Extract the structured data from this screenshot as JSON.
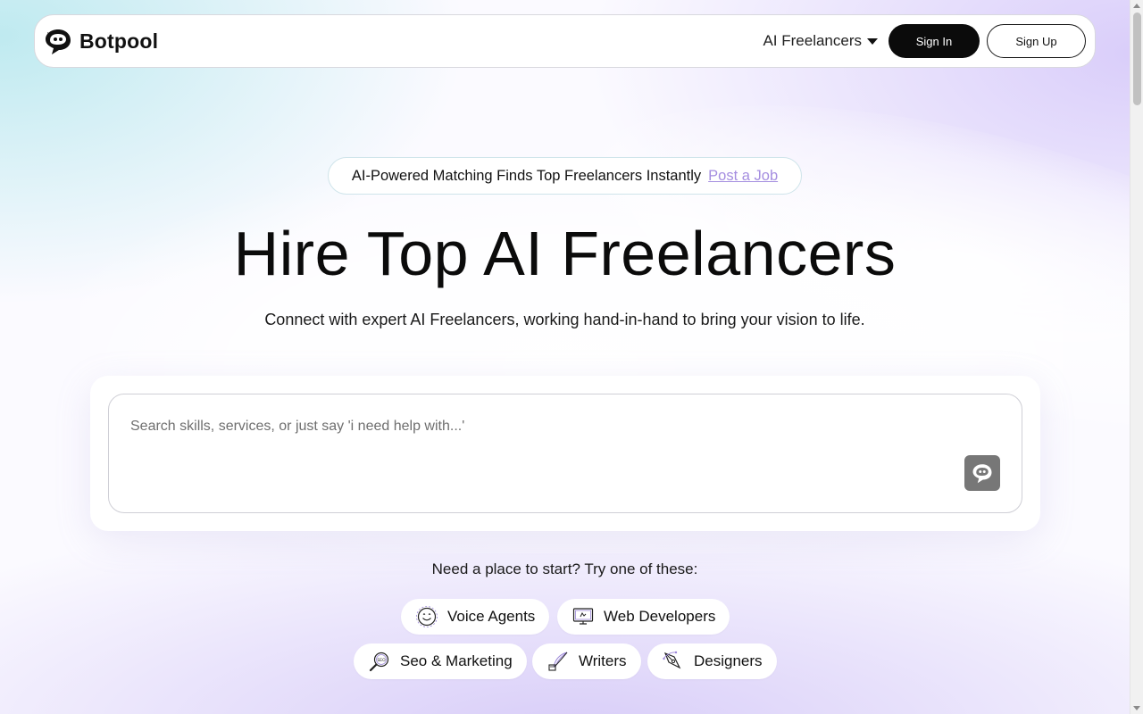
{
  "nav": {
    "brand": "Botpool",
    "dropdown_label": "AI Freelancers",
    "sign_in": "Sign In",
    "sign_up": "Sign Up"
  },
  "hero": {
    "pill_text": "AI-Powered Matching Finds Top Freelancers Instantly",
    "pill_link": "Post a Job",
    "title": "Hire Top AI Freelancers",
    "subtitle": "Connect with expert AI Freelancers, working hand-in-hand to bring your vision to life."
  },
  "search": {
    "placeholder": "Search skills, services, or just say 'i need help with...'",
    "value": ""
  },
  "suggestions": {
    "label": "Need a place to start? Try one of these:",
    "chips": [
      {
        "label": "Voice Agents",
        "icon": "smile-face-icon"
      },
      {
        "label": "Web Developers",
        "icon": "monitor-icon"
      },
      {
        "label": "Seo & Marketing",
        "icon": "seo-magnifier-icon"
      },
      {
        "label": "Writers",
        "icon": "quill-icon"
      },
      {
        "label": "Designers",
        "icon": "pen-tool-icon"
      }
    ]
  },
  "colors": {
    "accent_link": "#a58ee0",
    "button_dark": "#0b0b0b",
    "search_button": "#777777"
  }
}
